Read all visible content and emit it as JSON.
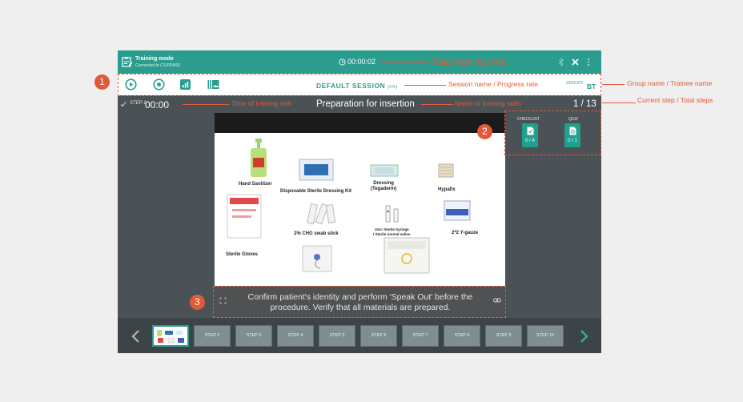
{
  "header": {
    "mode_title": "Training mode",
    "mode_subtitle": "Connected to CSIPDM02",
    "timer": "00:00:02"
  },
  "session": {
    "name": "DEFAULT SESSION",
    "rate": "(0%)",
    "group": "GROUP1",
    "trainee": "BT"
  },
  "step": {
    "label": "STEP 1",
    "time": "00:00",
    "skill_name": "Preparation for insertion",
    "counter": "1 / 13"
  },
  "image_items": {
    "hand_sanitizer": "Hand Sanitizer",
    "dressing_kit": "Disposable Sterile Dressing Kit",
    "dressing": "Dressing\n(Tegaderm)",
    "hypafix": "Hypafix",
    "chg_swab": "2% CHG swab stick",
    "syringe": "10cc Sterile Syringe\n/ Sterile normal saline",
    "gauze": "2*2 Y-gauze",
    "gloves": "Sterile Gloves",
    "needle": "Gripper plus needle",
    "box": "Medical waste bin"
  },
  "instruction": "Confirm patient's identity and perform 'Speak Out' before the procedure. Verify that all materials are prepared.",
  "cards": {
    "checklist": {
      "label": "CHECKLIST",
      "count": "0 / 4"
    },
    "quiz": {
      "label": "QUIZ",
      "count": "0 / 1"
    }
  },
  "filmstrip": {
    "steps": [
      "STEP 1",
      "STEP 2",
      "STEP 3",
      "STEP 4",
      "STEP 5",
      "STEP 6",
      "STEP 7",
      "STEP 8",
      "STEP 9",
      "STEP 10"
    ]
  },
  "annotations": {
    "badge_1": "1",
    "badge_2": "2",
    "badge_3": "3",
    "total_training_time": "Total training time",
    "session_name": "Session name / Progress rate",
    "group_trainee": "Group name / Trainee name",
    "time_skill": "Time of training skill",
    "name_skill": "Name of training skills",
    "current_step": "Current step / Total steps"
  },
  "colors": {
    "accent": "#2a9d8f",
    "annotation": "#e05a3a",
    "panel": "#4a5256"
  }
}
